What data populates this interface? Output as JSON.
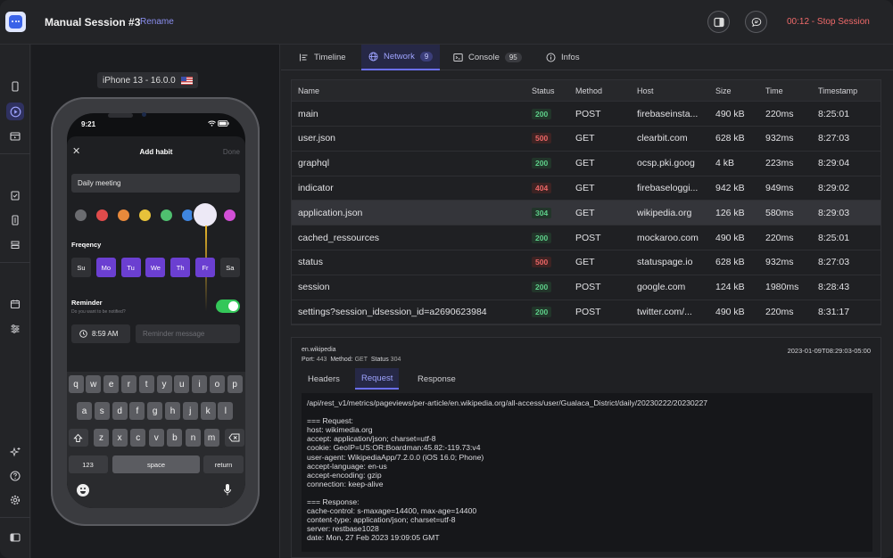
{
  "session": {
    "title": "Manual Session #3",
    "rename_label": "Rename",
    "stop_label": "00:12 - Stop Session"
  },
  "device": {
    "label": "iPhone 13 - 16.0.0"
  },
  "phone": {
    "time": "9:21",
    "sheet": {
      "title": "Add habit",
      "done": "Done",
      "name_value": "Daily meeting"
    },
    "colors": [
      "#6b6c70",
      "#e04b4b",
      "#e8893b",
      "#e6c23a",
      "#4fbf6f",
      "#3f86e0",
      "#ede9f6",
      "#d24fd6"
    ],
    "frequency_label": "Freqency",
    "days": [
      {
        "label": "Su",
        "on": false
      },
      {
        "label": "Mo",
        "on": true
      },
      {
        "label": "Tu",
        "on": true
      },
      {
        "label": "We",
        "on": true
      },
      {
        "label": "Th",
        "on": true
      },
      {
        "label": "Fr",
        "on": true
      },
      {
        "label": "Sa",
        "on": false
      }
    ],
    "reminder_label": "Reminder",
    "reminder_sub": "Do you want to be notified?",
    "reminder_time": "8:59 AM",
    "reminder_placeholder": "Reminder message",
    "keyboard": {
      "row1": [
        "q",
        "w",
        "e",
        "r",
        "t",
        "y",
        "u",
        "i",
        "o",
        "p"
      ],
      "row2": [
        "a",
        "s",
        "d",
        "f",
        "g",
        "h",
        "j",
        "k",
        "l"
      ],
      "row3": [
        "z",
        "x",
        "c",
        "v",
        "b",
        "n",
        "m"
      ],
      "num": "123",
      "space": "space",
      "return": "return"
    }
  },
  "tabs": [
    {
      "label": "Timeline",
      "badge": ""
    },
    {
      "label": "Network",
      "badge": "9"
    },
    {
      "label": "Console",
      "badge": "95"
    },
    {
      "label": "Infos",
      "badge": ""
    }
  ],
  "table": {
    "columns": [
      "Name",
      "Status",
      "Method",
      "Host",
      "Size",
      "Time",
      "Timestamp"
    ],
    "rows": [
      {
        "name": "main",
        "status": "200",
        "method": "POST",
        "host": "firebaseinsta...",
        "size": "490 kB",
        "time": "220ms",
        "ts": "8:25:01"
      },
      {
        "name": "user.json",
        "status": "500",
        "method": "GET",
        "host": "clearbit.com",
        "size": "628 kB",
        "time": "932ms",
        "ts": "8:27:03"
      },
      {
        "name": "graphql",
        "status": "200",
        "method": "GET",
        "host": "ocsp.pki.goog",
        "size": "4 kB",
        "time": "223ms",
        "ts": "8:29:04"
      },
      {
        "name": "indicator",
        "status": "404",
        "method": "GET",
        "host": "firebaseloggi...",
        "size": "942 kB",
        "time": "949ms",
        "ts": "8:29:02"
      },
      {
        "name": "application.json",
        "status": "304",
        "method": "GET",
        "host": "wikipedia.org",
        "size": "126 kB",
        "time": "580ms",
        "ts": "8:29:03"
      },
      {
        "name": "cached_ressources",
        "status": "200",
        "method": "POST",
        "host": "mockaroo.com",
        "size": "490 kB",
        "time": "220ms",
        "ts": "8:25:01"
      },
      {
        "name": "status",
        "status": "500",
        "method": "GET",
        "host": "statuspage.io",
        "size": "628 kB",
        "time": "932ms",
        "ts": "8:27:03"
      },
      {
        "name": "session",
        "status": "200",
        "method": "POST",
        "host": "google.com",
        "size": "124 kB",
        "time": "1980ms",
        "ts": "8:28:43"
      },
      {
        "name": "settings?session_idsession_id=a2690623984",
        "status": "200",
        "method": "POST",
        "host": "twitter.com/...",
        "size": "490 kB",
        "time": "220ms",
        "ts": "8:31:17"
      }
    ]
  },
  "detail": {
    "host": "en.wikipedia",
    "port_label": "Port:",
    "port": "443",
    "method_label": "Method:",
    "method": "GET",
    "status_label": "Status",
    "status": "304",
    "timestamp": "2023-01-09T08:29:03-05:00",
    "tabs": [
      "Headers",
      "Request",
      "Response"
    ],
    "body": "/api/rest_v1/metrics/pageviews/per-article/en.wikipedia.org/all-access/user/Gualaca_District/daily/20230222/20230227\n\n=== Request:\nhost: wikimedia.org\naccept: application/json; charset=utf-8\ncookie: GeoIP=US:OR:Boardman:45.82:-119.73:v4\nuser-agent: WikipediaApp/7.2.0.0 (iOS 16.0; Phone)\naccept-language: en-us\naccept-encoding: gzip\nconnection: keep-alive\n\n=== Response:\ncache-control: s-maxage=14400, max-age=14400\ncontent-type: application/json; charset=utf-8\nserver: restbase1028\ndate: Mon, 27 Feb 2023 19:09:05 GMT"
  }
}
